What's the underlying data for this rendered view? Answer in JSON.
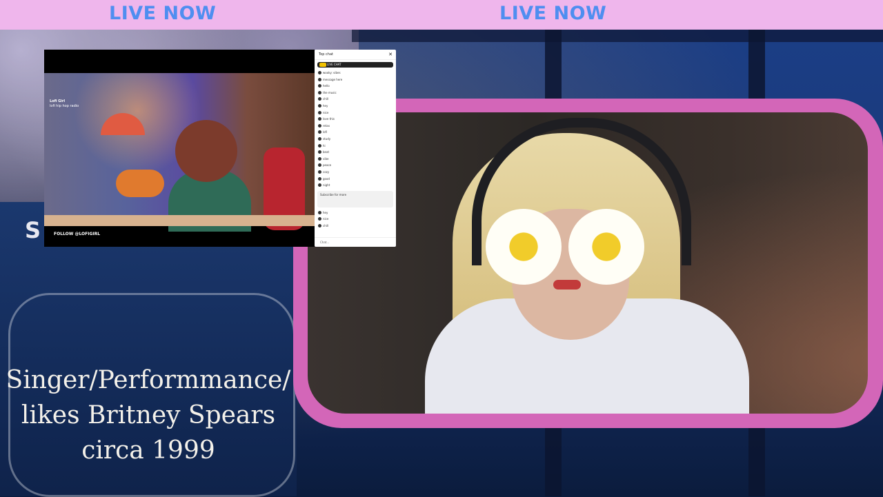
{
  "header": {
    "left_label": "LIVE NOW",
    "right_label": "LIVE NOW",
    "label_color": "#4f8ef0",
    "bar_color": "#efb6ec"
  },
  "left_panel": {
    "partial_text": "S",
    "caption_lines": [
      "Singer/Performmance/",
      "likes Britney Spears",
      "circa 1999"
    ]
  },
  "cam": {
    "frame_color": "#d366b8",
    "subject_desc_icon": "person-daisy-sunglasses"
  },
  "player": {
    "follow_badge": "FOLLOW @LOFIGIRL",
    "channel_line1": "Lofi Girl",
    "channel_line2": "lofi hip hop radio"
  },
  "chat": {
    "title": "Top chat",
    "pinned": "LIVE CHAT",
    "messages": [
      "wooky: vibes",
      "message here",
      "hello",
      "the music",
      "chill",
      "hey",
      "nice",
      "love this",
      "relax",
      "lofi",
      "study",
      "hi",
      "beat",
      "vibe",
      "peace",
      "cozy",
      "good",
      "night"
    ],
    "banner_text": "Subscribe for more",
    "messages_after": [
      "hey",
      "nice",
      "chill"
    ],
    "footer": "Chat..."
  }
}
